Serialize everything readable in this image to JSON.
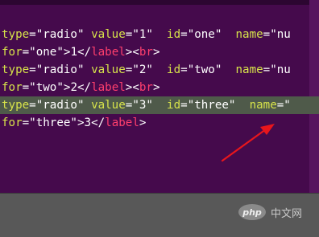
{
  "editor": {
    "lines": [
      {
        "highlighted": false,
        "tokens": [
          {
            "t": "attr",
            "v": "type"
          },
          {
            "t": "eq",
            "v": "="
          },
          {
            "t": "str",
            "v": "\"radio\""
          },
          {
            "t": "text",
            "v": " "
          },
          {
            "t": "attr",
            "v": "value"
          },
          {
            "t": "eq",
            "v": "="
          },
          {
            "t": "str",
            "v": "\"1\""
          },
          {
            "t": "text",
            "v": "  "
          },
          {
            "t": "attr",
            "v": "id"
          },
          {
            "t": "eq",
            "v": "="
          },
          {
            "t": "str",
            "v": "\"one\""
          },
          {
            "t": "text",
            "v": "  "
          },
          {
            "t": "attr",
            "v": "name"
          },
          {
            "t": "eq",
            "v": "="
          },
          {
            "t": "str",
            "v": "\"nu"
          }
        ]
      },
      {
        "highlighted": false,
        "tokens": [
          {
            "t": "attr",
            "v": "for"
          },
          {
            "t": "eq",
            "v": "="
          },
          {
            "t": "str",
            "v": "\"one\""
          },
          {
            "t": "punct",
            "v": ">"
          },
          {
            "t": "text",
            "v": "1"
          },
          {
            "t": "punct",
            "v": "</"
          },
          {
            "t": "tag",
            "v": "label"
          },
          {
            "t": "punct",
            "v": "><"
          },
          {
            "t": "tag",
            "v": "br"
          },
          {
            "t": "punct",
            "v": ">"
          }
        ]
      },
      {
        "highlighted": false,
        "tokens": [
          {
            "t": "attr",
            "v": "type"
          },
          {
            "t": "eq",
            "v": "="
          },
          {
            "t": "str",
            "v": "\"radio\""
          },
          {
            "t": "text",
            "v": " "
          },
          {
            "t": "attr",
            "v": "value"
          },
          {
            "t": "eq",
            "v": "="
          },
          {
            "t": "str",
            "v": "\"2\""
          },
          {
            "t": "text",
            "v": "  "
          },
          {
            "t": "attr",
            "v": "id"
          },
          {
            "t": "eq",
            "v": "="
          },
          {
            "t": "str",
            "v": "\"two\""
          },
          {
            "t": "text",
            "v": "  "
          },
          {
            "t": "attr",
            "v": "name"
          },
          {
            "t": "eq",
            "v": "="
          },
          {
            "t": "str",
            "v": "\"nu"
          }
        ]
      },
      {
        "highlighted": false,
        "tokens": [
          {
            "t": "attr",
            "v": "for"
          },
          {
            "t": "eq",
            "v": "="
          },
          {
            "t": "str",
            "v": "\"two\""
          },
          {
            "t": "punct",
            "v": ">"
          },
          {
            "t": "text",
            "v": "2"
          },
          {
            "t": "punct",
            "v": "</"
          },
          {
            "t": "tag",
            "v": "label"
          },
          {
            "t": "punct",
            "v": "><"
          },
          {
            "t": "tag",
            "v": "br"
          },
          {
            "t": "punct",
            "v": ">"
          }
        ]
      },
      {
        "highlighted": true,
        "tokens": [
          {
            "t": "attr",
            "v": "type"
          },
          {
            "t": "eq",
            "v": "="
          },
          {
            "t": "str",
            "v": "\"radio\""
          },
          {
            "t": "text",
            "v": " "
          },
          {
            "t": "attr",
            "v": "value"
          },
          {
            "t": "eq",
            "v": "="
          },
          {
            "t": "str",
            "v": "\"3\""
          },
          {
            "t": "text",
            "v": "  "
          },
          {
            "t": "attr",
            "v": "id"
          },
          {
            "t": "eq",
            "v": "="
          },
          {
            "t": "str",
            "v": "\"three\""
          },
          {
            "t": "text",
            "v": "  "
          },
          {
            "t": "attr",
            "v": "name"
          },
          {
            "t": "eq",
            "v": "="
          },
          {
            "t": "str",
            "v": "\""
          }
        ]
      },
      {
        "highlighted": false,
        "tokens": [
          {
            "t": "attr",
            "v": "for"
          },
          {
            "t": "eq",
            "v": "="
          },
          {
            "t": "str",
            "v": "\"three\""
          },
          {
            "t": "punct",
            "v": ">"
          },
          {
            "t": "text",
            "v": "3"
          },
          {
            "t": "punct",
            "v": "</"
          },
          {
            "t": "tag",
            "v": "label"
          },
          {
            "t": "punct",
            "v": ">"
          }
        ]
      }
    ]
  },
  "annotation": {
    "icon": "red-arrow-icon",
    "color": "#e8161c"
  },
  "watermark": {
    "logo_text": "php",
    "site_text": "中文网"
  },
  "colors": {
    "editor_background": "#450a4c",
    "attribute": "#d7e34a",
    "tag_name": "#ff3f6d",
    "plain_text": "#ffffff",
    "highlight_line": "#4f5a4a"
  }
}
